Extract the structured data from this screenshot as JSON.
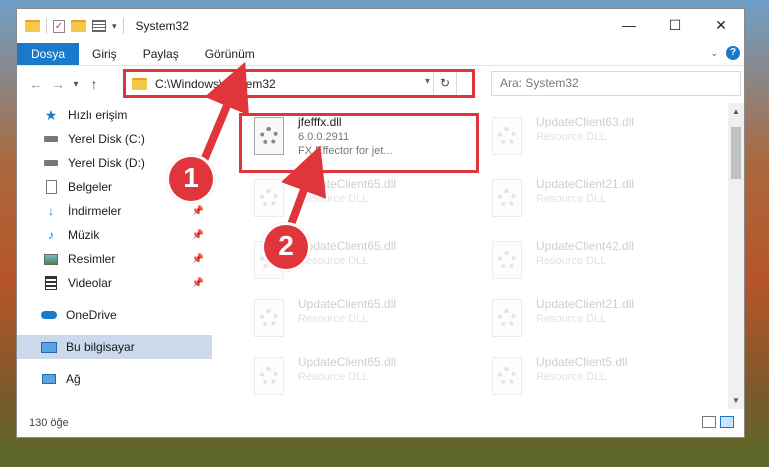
{
  "window": {
    "title": "System32",
    "controls": {
      "minimize": "—",
      "maximize": "☐",
      "close": "✕"
    }
  },
  "ribbon": {
    "tabs": [
      "Dosya",
      "Giriş",
      "Paylaş",
      "Görünüm"
    ],
    "active_tab": "Dosya"
  },
  "navigation": {
    "back": "←",
    "forward": "→",
    "recent": "▾",
    "up": "↑",
    "address": "C:\\Windows\\System32",
    "search_placeholder": "Ara: System32"
  },
  "sidebar": {
    "items": [
      {
        "label": "Hızlı erişim",
        "icon": "star-icon"
      },
      {
        "label": "Yerel Disk (C:)",
        "icon": "drive-icon"
      },
      {
        "label": "Yerel Disk (D:)",
        "icon": "drive-icon"
      },
      {
        "label": "Belgeler",
        "icon": "documents-icon"
      },
      {
        "label": "İndirmeler",
        "icon": "download-icon",
        "pinned": true
      },
      {
        "label": "Müzik",
        "icon": "music-icon",
        "pinned": true
      },
      {
        "label": "Resimler",
        "icon": "pictures-icon",
        "pinned": true
      },
      {
        "label": "Videolar",
        "icon": "videos-icon",
        "pinned": true
      },
      {
        "label": "OneDrive",
        "icon": "cloud-icon"
      },
      {
        "label": "Bu bilgisayar",
        "icon": "computer-icon",
        "selected": true
      },
      {
        "label": "Ağ",
        "icon": "network-icon"
      }
    ]
  },
  "files": [
    {
      "name": "jfefffx.dll",
      "version": "6.0.0.2911",
      "description": "FX Effector for jet...",
      "highlighted": true
    },
    {
      "name": "UpdateClient63.dll",
      "description": "Resource DLL"
    },
    {
      "name": "UpdateClient65.dll",
      "description": "Resource DLL"
    },
    {
      "name": "UpdateClient21.dll",
      "description": "Resource DLL"
    },
    {
      "name": "UpdateClient65.dll",
      "description": "Resource DLL"
    },
    {
      "name": "UpdateClient42.dll",
      "description": "Resource DLL"
    },
    {
      "name": "UpdateClient65.dll",
      "description": "Resource DLL"
    },
    {
      "name": "UpdateClient21.dll",
      "description": "Resource DLL"
    },
    {
      "name": "UpdateClient65.dll",
      "description": "Resource DLL"
    },
    {
      "name": "UpdateClient5.dll",
      "description": "Resource DLL"
    }
  ],
  "status": {
    "count": "130 öğe"
  },
  "annotations": {
    "step1": "1",
    "step2": "2",
    "color": "#e0353a"
  }
}
